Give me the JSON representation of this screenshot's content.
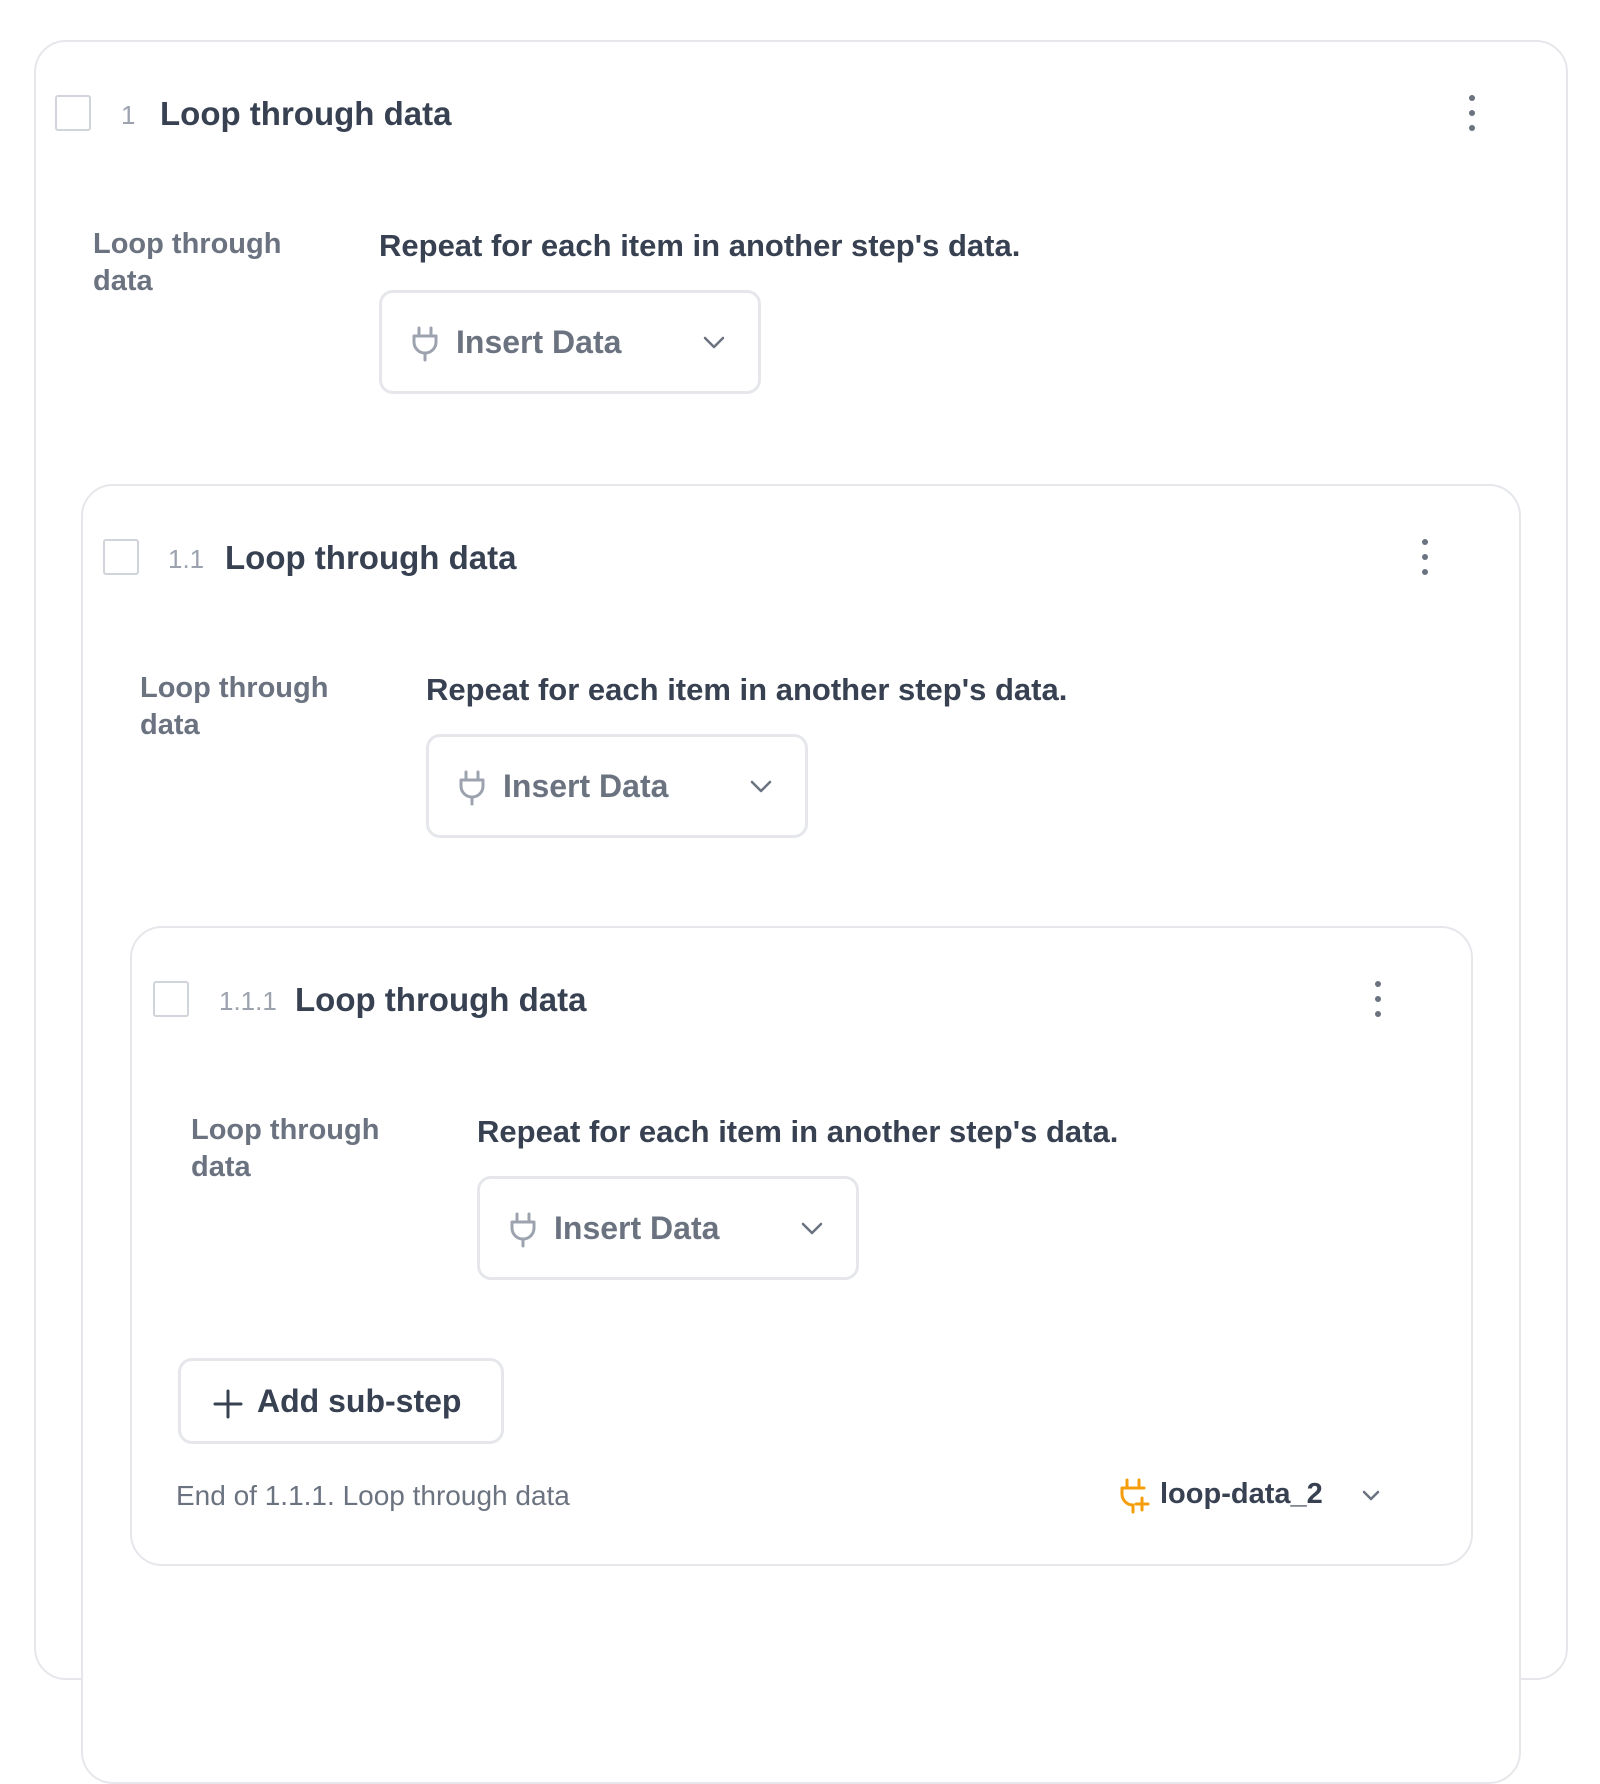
{
  "steps": [
    {
      "number": "1",
      "title": "Loop through data",
      "field_label": "Loop through data",
      "field_description": "Repeat for each item in another step's data.",
      "insert_label": "Insert Data"
    },
    {
      "number": "1.1",
      "title": "Loop through data",
      "field_label": "Loop through data",
      "field_description": "Repeat for each item in another step's data.",
      "insert_label": "Insert Data"
    },
    {
      "number": "1.1.1",
      "title": "Loop through data",
      "field_label": "Loop through data",
      "field_description": "Repeat for each item in another step's data.",
      "insert_label": "Insert Data",
      "add_substep_label": "Add sub-step",
      "end_text": "End of 1.1.1. Loop through data",
      "loop_variable": "loop-data_2"
    }
  ],
  "icons": {
    "insert": "plug-icon",
    "dropdown": "chevron-down-icon",
    "menu": "kebab-menu-icon",
    "add": "plus-icon",
    "loop_variable": "plug-plus-icon"
  },
  "colors": {
    "border": "#e5e7eb",
    "text_primary": "#374151",
    "text_muted": "#6b7280",
    "accent": "#f59e0b"
  }
}
